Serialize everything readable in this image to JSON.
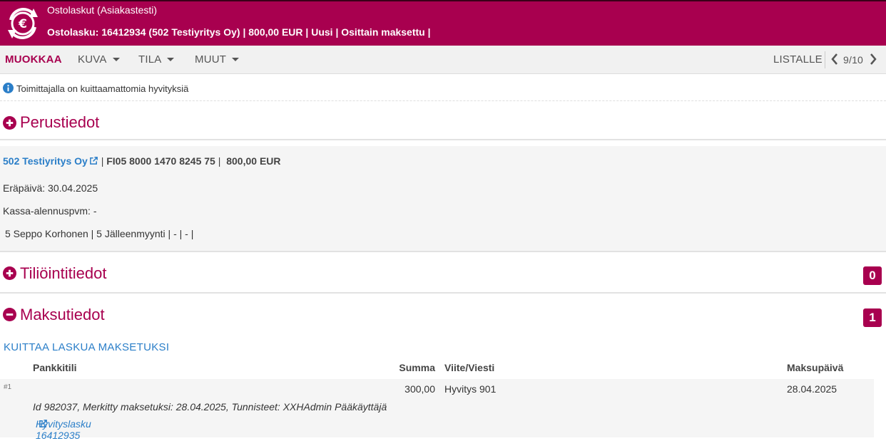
{
  "header": {
    "app_name": "Ostolaskut (Asiakastesti)",
    "invoice_summary": "Ostolasku: 16412934 (502 Testiyritys Oy) | 800,00 EUR | Uusi | Osittain maksettu |",
    "logo_icon": "euro-refresh-icon",
    "color": "#a8004f"
  },
  "nav": {
    "edit": "MUOKKAA",
    "image": "KUVA",
    "state": "TILA",
    "other": "MUUT",
    "to_list": "LISTALLE",
    "pager": "9/10"
  },
  "notice": {
    "text": "Toimittajalla on kuittaamattomia hyvityksiä",
    "icon": "info-icon"
  },
  "sections": {
    "basic": {
      "title": "Perustiedot"
    },
    "accounting": {
      "title": "Tiliöintitiedot",
      "count": "0"
    },
    "payment": {
      "title": "Maksutiedot",
      "count": "1"
    }
  },
  "basic": {
    "supplier": "502 Testiyritys Oy",
    "sep1": "|",
    "iban": "FI05 8000 1470 8245 75",
    "sep2": "|",
    "amount": "800,00 EUR",
    "due_date": "Eräpäivä: 30.04.2025",
    "cash_discount": "Kassa-alennuspvm: -",
    "dimensions": "5 Seppo Korhonen | 5 Jälleenmyynti | - | - |"
  },
  "payment": {
    "mark_paid": "KUITTAA LASKUA MAKSETUKSI",
    "columns": {
      "account": "Pankkitili",
      "sum": "Summa",
      "reference": "Viite/Viesti",
      "date": "Maksupäivä"
    },
    "rows": [
      {
        "num": "#1",
        "sum": "300,00",
        "reference": "Hyvitys 901",
        "date": "28.04.2025",
        "meta": "Id 982037, Merkitty maksetuksi: 28.04.2025, Tunnisteet: XXHAdmin Pääkäyttäjä",
        "credit_link": "Hyvityslasku 16412935"
      }
    ]
  }
}
